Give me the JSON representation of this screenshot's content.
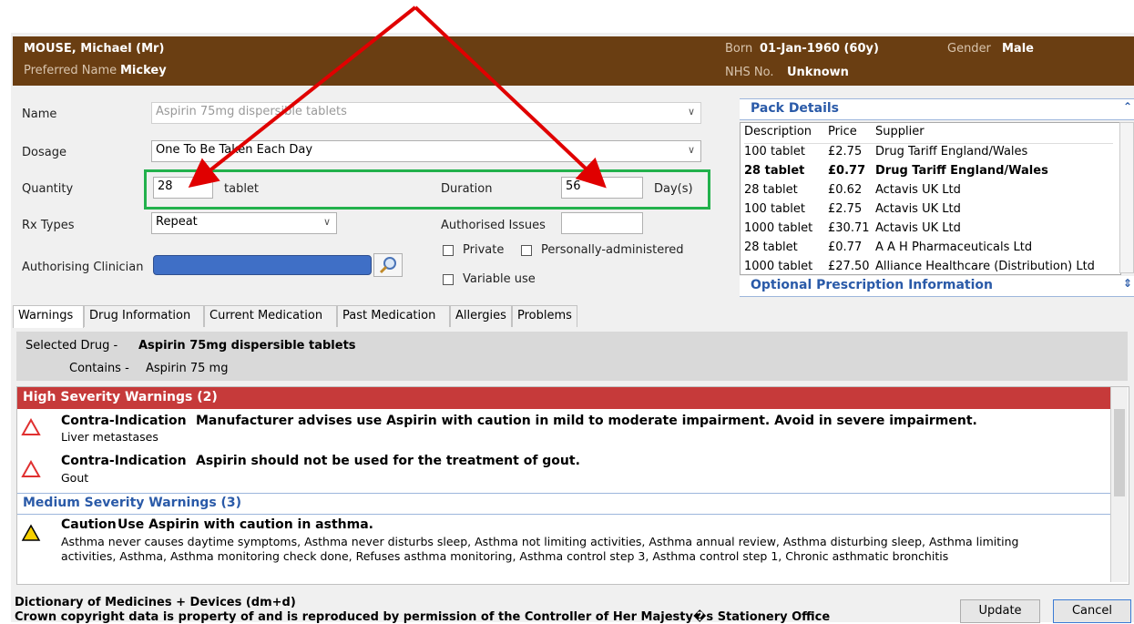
{
  "patient": {
    "name": "MOUSE, Michael (Mr)",
    "preferred_name_label": "Preferred Name",
    "preferred_name": "Mickey",
    "born_label": "Born",
    "born": "01-Jan-1960 (60y)",
    "gender_label": "Gender",
    "gender": "Male",
    "nhs_label": "NHS No.",
    "nhs": "Unknown"
  },
  "form": {
    "name_label": "Name",
    "name_value": "Aspirin 75mg dispersible tablets",
    "dosage_label": "Dosage",
    "dosage_value": "One To Be Taken Each Day",
    "quantity_label": "Quantity",
    "quantity_value": "28",
    "quantity_unit": "tablet",
    "duration_label": "Duration",
    "duration_value": "56",
    "duration_unit": "Day(s)",
    "rx_types_label": "Rx Types",
    "rx_types_value": "Repeat",
    "authorised_issues_label": "Authorised Issues",
    "authorised_issues_value": "",
    "private_label": "Private",
    "personally_administered_label": "Personally-administered",
    "variable_use_label": "Variable use",
    "clinician_label": "Authorising Clinician"
  },
  "pack_details": {
    "title": "Pack Details",
    "columns": [
      "Description",
      "Price",
      "Supplier"
    ],
    "rows": [
      {
        "description": "100 tablet",
        "price": "£2.75",
        "supplier": "Drug Tariff England/Wales",
        "bold": false
      },
      {
        "description": "28 tablet",
        "price": "£0.77",
        "supplier": "Drug Tariff England/Wales",
        "bold": true
      },
      {
        "description": "28 tablet",
        "price": "£0.62",
        "supplier": "Actavis UK Ltd",
        "bold": false
      },
      {
        "description": "100 tablet",
        "price": "£2.75",
        "supplier": "Actavis UK Ltd",
        "bold": false
      },
      {
        "description": "1000 tablet",
        "price": "£30.71",
        "supplier": "Actavis UK Ltd",
        "bold": false
      },
      {
        "description": "28 tablet",
        "price": "£0.77",
        "supplier": "A A H Pharmaceuticals Ltd",
        "bold": false
      },
      {
        "description": "1000 tablet",
        "price": "£27.50",
        "supplier": "Alliance Healthcare (Distribution) Ltd",
        "bold": false
      }
    ]
  },
  "optional_title": "Optional Prescription Information",
  "tabs": [
    "Warnings",
    "Drug Information",
    "Current Medication",
    "Past Medication",
    "Allergies",
    "Problems"
  ],
  "drug_panel": {
    "selected_label": "Selected Drug -",
    "selected_value": "Aspirin 75mg dispersible tablets",
    "contains_label": "Contains -",
    "contains_value": "Aspirin 75 mg"
  },
  "warnings": {
    "high_header": "High Severity Warnings (2)",
    "high": [
      {
        "type": "Contra-Indication",
        "text": "Manufacturer advises use Aspirin with caution in mild to moderate impairment. Avoid in severe impairment.",
        "sub": "Liver metastases"
      },
      {
        "type": "Contra-Indication",
        "text": "Aspirin should not be used for the treatment of gout.",
        "sub": "Gout"
      }
    ],
    "medium_header": "Medium Severity Warnings (3)",
    "medium": [
      {
        "type": "Caution",
        "text": "Use Aspirin with caution in asthma.",
        "sub1": "Asthma never causes daytime symptoms, Asthma never disturbs sleep, Asthma not limiting activities, Asthma annual review, Asthma disturbing sleep, Asthma limiting",
        "sub2": "activities, Asthma, Asthma monitoring check done, Refuses asthma monitoring, Asthma control step 3, Asthma control step 1, Chronic asthmatic bronchitis"
      }
    ]
  },
  "footer": {
    "line1": "Dictionary of Medicines + Devices (dm+d)",
    "line2": "Crown copyright data is property of and is reproduced by permission of the Controller of Her Majesty�s Stationery Office"
  },
  "buttons": {
    "update": "Update",
    "cancel": "Cancel"
  },
  "colors": {
    "header_bg": "#6a3e12",
    "high_warning": "#c63a3a",
    "annotation_red": "#e00000",
    "annotation_green": "#22b14c",
    "clinician_blue": "#3f6fc6"
  }
}
